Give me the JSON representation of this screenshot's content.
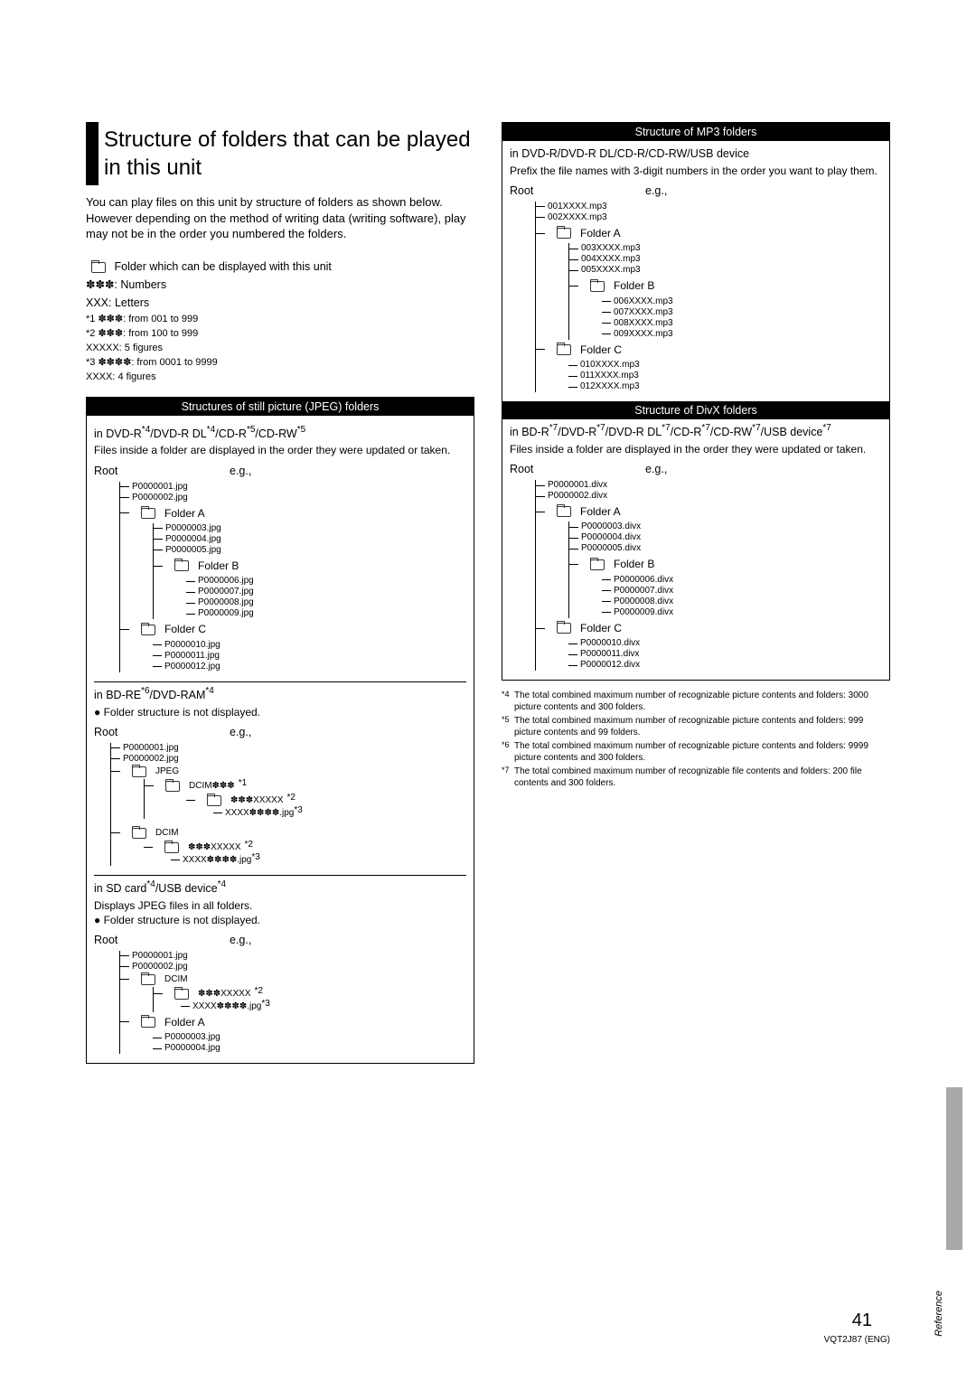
{
  "main_title": "Structure of folders that can be played in this unit",
  "intro": "You can play files on this unit by structure of folders as shown below. However depending on the method of writing data (writing software), play may not be in the order you numbered the folders.",
  "legend": {
    "folder": "Folder which can be displayed with this unit",
    "stars_numbers": "✽✽✽: Numbers",
    "xxx_letters": "XXX: Letters"
  },
  "footnotes_top": [
    "*1  ✽✽✽: from 001 to 999",
    "*2  ✽✽✽: from 100 to 999",
    "    XXXXX: 5 figures",
    "*3  ✽✽✽✽: from 0001 to 9999",
    "    XXXX: 4 figures"
  ],
  "jpeg_panel": {
    "header": "Structures of still picture (JPEG) folders",
    "sec1": {
      "device": "in DVD-R*4/DVD-R DL*4/CD-R*5/CD-RW*5",
      "desc": "Files inside a folder are displayed in the order they were updated or taken.",
      "root": "Root",
      "eg": "e.g.,",
      "tree": {
        "root_files": [
          "P0000001.jpg",
          "P0000002.jpg"
        ],
        "folderA": {
          "name": "Folder A",
          "files": [
            "P0000003.jpg",
            "P0000004.jpg",
            "P0000005.jpg"
          ]
        },
        "folderB": {
          "name": "Folder B",
          "files": [
            "P0000006.jpg",
            "P0000007.jpg",
            "P0000008.jpg",
            "P0000009.jpg"
          ]
        },
        "folderC": {
          "name": "Folder C",
          "files": [
            "P0000010.jpg",
            "P0000011.jpg",
            "P0000012.jpg"
          ]
        }
      }
    },
    "sec2": {
      "device": "in BD-RE*6/DVD-RAM*4",
      "bullet": "Folder structure is not displayed.",
      "root": "Root",
      "eg": "e.g.,",
      "tree": {
        "root_files": [
          "P0000001.jpg",
          "P0000002.jpg"
        ],
        "jpeg": {
          "name": "JPEG",
          "dcim": "DCIM✽✽✽",
          "star1": "*1",
          "sub1": "✽✽✽XXXXX",
          "star2": "*2",
          "sub2": "XXXX✽✽✽✽.jpg",
          "star3": "*3"
        },
        "dcim": {
          "name": "DCIM",
          "sub1": "✽✽✽XXXXX",
          "star2": "*2",
          "sub2": "XXXX✽✽✽✽.jpg",
          "star3": "*3"
        }
      }
    },
    "sec3": {
      "device": "in SD card*4/USB device*4",
      "line1": "Displays JPEG files in all folders.",
      "bullet": "Folder structure is not displayed.",
      "root": "Root",
      "eg": "e.g.,",
      "tree": {
        "root_files": [
          "P0000001.jpg",
          "P0000002.jpg"
        ],
        "dcim": {
          "name": "DCIM",
          "sub1": "✽✽✽XXXXX",
          "star2": "*2",
          "sub2": "XXXX✽✽✽✽.jpg",
          "star3": "*3"
        },
        "folderA": {
          "name": "Folder A",
          "files": [
            "P0000003.jpg",
            "P0000004.jpg"
          ]
        }
      }
    }
  },
  "mp3_panel": {
    "header": "Structure of MP3 folders",
    "device": "in DVD-R/DVD-R DL/CD-R/CD-RW/USB device",
    "desc": "Prefix the file names with 3-digit numbers in the order you want to play them.",
    "root": "Root",
    "eg": "e.g.,",
    "tree": {
      "root_files": [
        "001XXXX.mp3",
        "002XXXX.mp3"
      ],
      "folderA": {
        "name": "Folder A",
        "files": [
          "003XXXX.mp3",
          "004XXXX.mp3",
          "005XXXX.mp3"
        ]
      },
      "folderB": {
        "name": "Folder B",
        "files": [
          "006XXXX.mp3",
          "007XXXX.mp3",
          "008XXXX.mp3",
          "009XXXX.mp3"
        ]
      },
      "folderC": {
        "name": "Folder C",
        "files": [
          "010XXXX.mp3",
          "011XXXX.mp3",
          "012XXXX.mp3"
        ]
      }
    }
  },
  "divx_panel": {
    "header": "Structure of DivX folders",
    "device": "in BD-R*7/DVD-R*7/DVD-R DL*7/CD-R*7/CD-RW*7/USB device*7",
    "desc": "Files inside a folder are displayed in the order they were updated or taken.",
    "root": "Root",
    "eg": "e.g.,",
    "tree": {
      "root_files": [
        "P0000001.divx",
        "P0000002.divx"
      ],
      "folderA": {
        "name": "Folder A",
        "files": [
          "P0000003.divx",
          "P0000004.divx",
          "P0000005.divx"
        ]
      },
      "folderB": {
        "name": "Folder B",
        "files": [
          "P0000006.divx",
          "P0000007.divx",
          "P0000008.divx",
          "P0000009.divx"
        ]
      },
      "folderC": {
        "name": "Folder C",
        "files": [
          "P0000010.divx",
          "P0000011.divx",
          "P0000012.divx"
        ]
      }
    }
  },
  "footnotes_right": [
    {
      "num": "*4",
      "text": "The total combined maximum number of recognizable picture contents and folders: 3000 picture contents and 300 folders."
    },
    {
      "num": "*5",
      "text": "The total combined maximum number of recognizable picture contents and folders: 999 picture contents and 99 folders."
    },
    {
      "num": "*6",
      "text": "The total combined maximum number of recognizable picture contents and folders: 9999 picture contents and 300 folders."
    },
    {
      "num": "*7",
      "text": "The total combined maximum number of recognizable file contents and folders: 200 file contents and 300 folders."
    }
  ],
  "page_num": "41",
  "doc_ref": "VQT2J87 (ENG)",
  "side_tab": "Reference"
}
